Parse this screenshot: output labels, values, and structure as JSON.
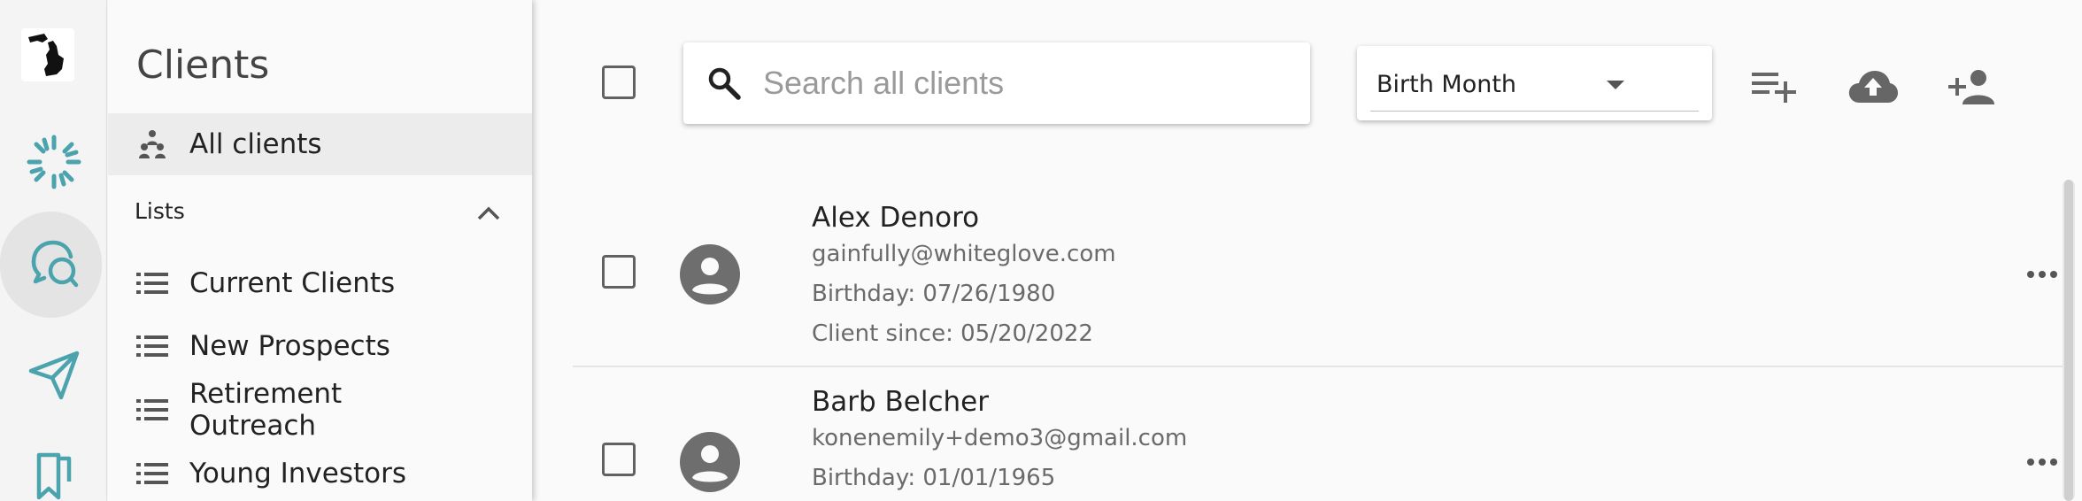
{
  "rail": {
    "logo_icon": "michigan-logo-icon",
    "items": [
      {
        "icon": "spinner-burst-icon",
        "label": "Activity"
      },
      {
        "icon": "chat-bubbles-icon",
        "label": "Conversations",
        "active": true
      },
      {
        "icon": "send-icon",
        "label": "Send"
      },
      {
        "icon": "bookmark-icon",
        "label": "Bookmarks"
      }
    ],
    "accent_color": "#4ba3ad"
  },
  "sidebar": {
    "title": "Clients",
    "all_clients_label": "All clients",
    "lists_header": "Lists",
    "lists": [
      {
        "label": "Current Clients"
      },
      {
        "label": "New Prospects"
      },
      {
        "label": "Retirement Outreach"
      },
      {
        "label": "Young Investors"
      }
    ]
  },
  "toolbar": {
    "search_placeholder": "Search all clients",
    "search_value": "",
    "sort_select_value": "Birth Month",
    "buttons": [
      "add-to-list-icon",
      "cloud-upload-icon",
      "add-person-icon"
    ]
  },
  "clients": [
    {
      "name": "Alex Denoro",
      "email": "gainfully@whiteglove.com",
      "birthday": "Birthday: 07/26/1980",
      "client_since": "Client since: 05/20/2022"
    },
    {
      "name": "Barb Belcher",
      "email": "konenemily+demo3@gmail.com",
      "birthday": "Birthday: 01/01/1965"
    }
  ]
}
